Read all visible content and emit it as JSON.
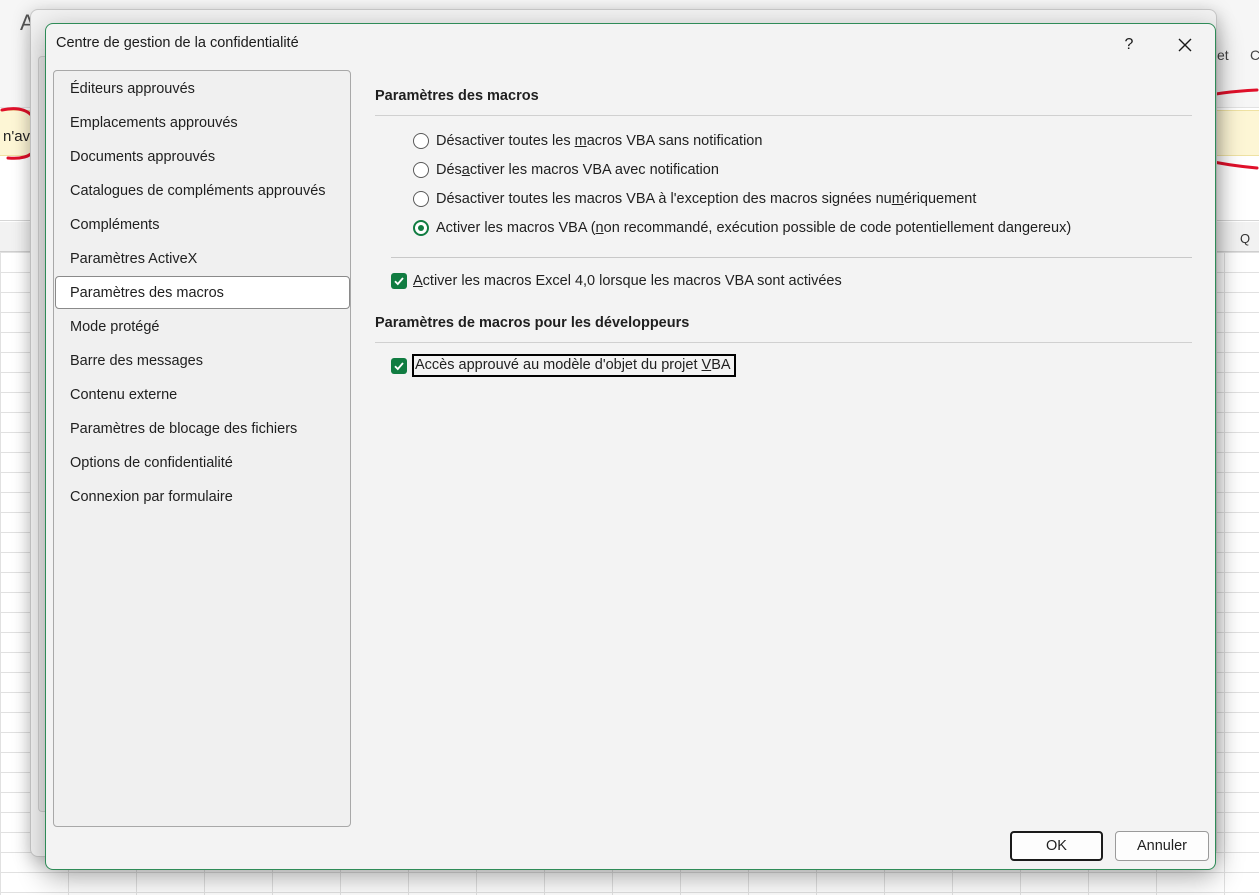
{
  "background": {
    "message_bar_fragment": "n'av",
    "column_letter": "Q",
    "ribbon_fragments": [
      "A",
      "et",
      "C"
    ]
  },
  "dialog": {
    "title": "Centre de gestion de la confidentialité",
    "help_label": "?",
    "nav_items": [
      "Éditeurs approuvés",
      "Emplacements approuvés",
      "Documents approuvés",
      "Catalogues de compléments approuvés",
      "Compléments",
      "Paramètres ActiveX",
      "Paramètres des macros",
      "Mode protégé",
      "Barre des messages",
      "Contenu externe",
      "Paramètres de blocage des fichiers",
      "Options de confidentialité",
      "Connexion par formulaire"
    ],
    "selected_nav": "Paramètres des macros",
    "macro_settings": {
      "title": "Paramètres des macros",
      "options": [
        {
          "pre": "Désactiver toutes les ",
          "ul": "m",
          "post": "acros VBA sans notification",
          "selected": false
        },
        {
          "pre": "Dés",
          "ul": "a",
          "post": "ctiver les macros VBA avec notification",
          "selected": false
        },
        {
          "pre": "Désactiver toutes les macros VBA à l'exception des macros signées nu",
          "ul": "m",
          "post": "ériquement",
          "selected": false
        },
        {
          "pre": "Activer les macros VBA (",
          "ul": "n",
          "post": "on recommandé, exécution possible de code potentiellement dangereux)",
          "selected": true
        }
      ],
      "excel4": {
        "ul": "A",
        "post": "ctiver les macros Excel 4,0 lorsque les macros VBA sont activées",
        "checked": true
      }
    },
    "developer_settings": {
      "title": "Paramètres de macros pour les développeurs",
      "vba_access": {
        "pre": "Accès approuvé au modèle d'objet du projet ",
        "ul": "V",
        "post": "BA",
        "checked": true
      }
    },
    "buttons": {
      "ok": "OK",
      "cancel": "Annuler"
    }
  },
  "colors": {
    "accent": "#107c41",
    "annotation": "#e0102a",
    "message_bar": "#fdf6d5"
  }
}
